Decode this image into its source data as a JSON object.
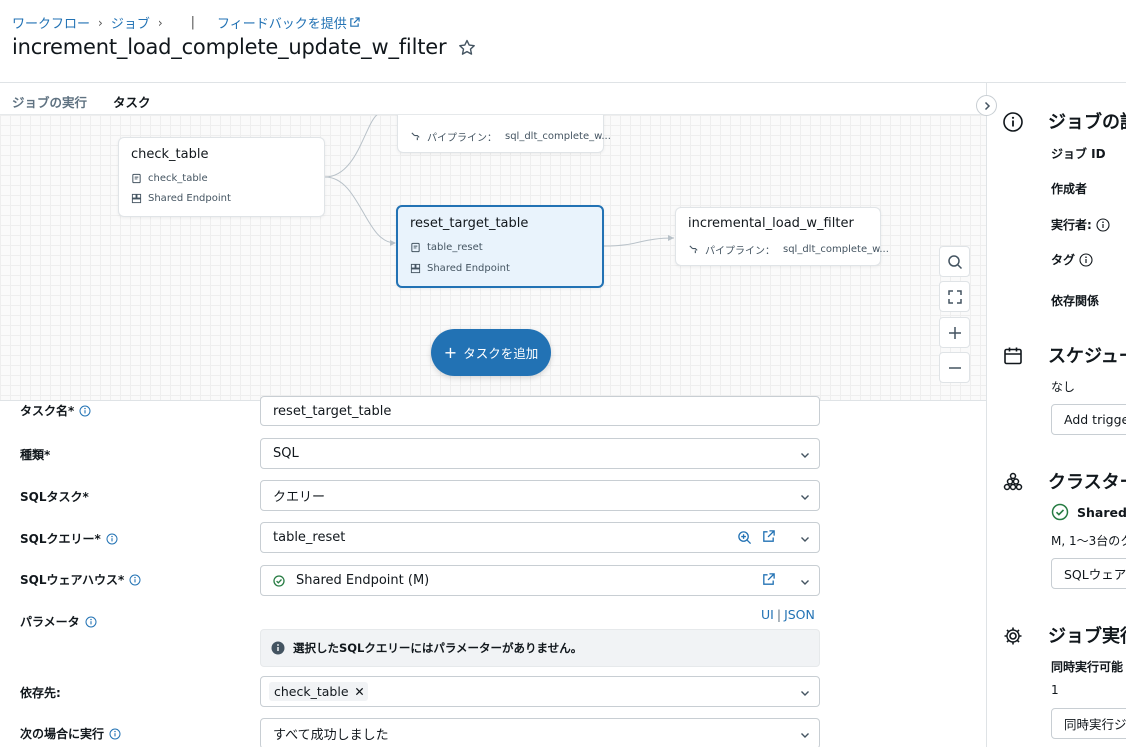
{
  "breadcrumb": {
    "workflows": "ワークフロー",
    "jobs": "ジョブ",
    "feedback": "フィードバックを提供"
  },
  "page_title": "increment_load_complete_update_w_filter",
  "tabs": [
    {
      "label": "ジョブの実行"
    },
    {
      "label": "タスク"
    }
  ],
  "dag": {
    "partial_node": {
      "title": "",
      "pipeline_label": "パイプライン：",
      "pipeline_value": "sql_dlt_complete_w..."
    },
    "check_table": {
      "title": "check_table",
      "query": "check_table",
      "endpoint": "Shared Endpoint"
    },
    "reset_target_table": {
      "title": "reset_target_table",
      "query": "table_reset",
      "endpoint": "Shared Endpoint"
    },
    "incremental_load": {
      "title": "incremental_load_w_filter",
      "pipeline_label": "パイプライン：",
      "pipeline_value": "sql_dlt_complete_w..."
    },
    "add_task": "タスクを追加"
  },
  "form": {
    "task_name": {
      "label": "タスク名*",
      "value": "reset_target_table"
    },
    "type": {
      "label": "種類*",
      "value": "SQL"
    },
    "sql_task": {
      "label": "SQLタスク*",
      "value": "クエリー"
    },
    "sql_query": {
      "label": "SQLクエリー*",
      "value": "table_reset"
    },
    "sql_warehouse": {
      "label": "SQLウェアハウス*",
      "value": "Shared Endpoint (M)"
    },
    "parameters": {
      "label": "パラメータ",
      "link_ui": "UI",
      "link_json": "JSON",
      "message": "選択したSQLクエリーにはパラメーターがありません。"
    },
    "depends_on": {
      "label": "依存先:",
      "chip": "check_table"
    },
    "run_if": {
      "label": "次の場合に実行",
      "value": "すべて成功しました"
    }
  },
  "right_panel": {
    "job_details": {
      "heading": "ジョブの詳",
      "job_id": "ジョブ ID",
      "creator": "作成者",
      "run_as": "実行者:",
      "tags": "タグ",
      "dependencies": "依存関係"
    },
    "schedule": {
      "heading": "スケジュー",
      "value": "なし",
      "button": "Add trigge"
    },
    "cluster": {
      "heading": "クラスター",
      "status": "Shared E",
      "desc": "M, 1〜3台のク",
      "button": "SQLウェア"
    },
    "job_run": {
      "heading": "ジョブ実行",
      "concurrent_label": "同時実行可能",
      "concurrent_value": "1",
      "button": "同時実行ジ"
    }
  },
  "colors": {
    "accent": "#2272b4",
    "success": "#277c43",
    "selected_bg": "#e9f3fc"
  }
}
